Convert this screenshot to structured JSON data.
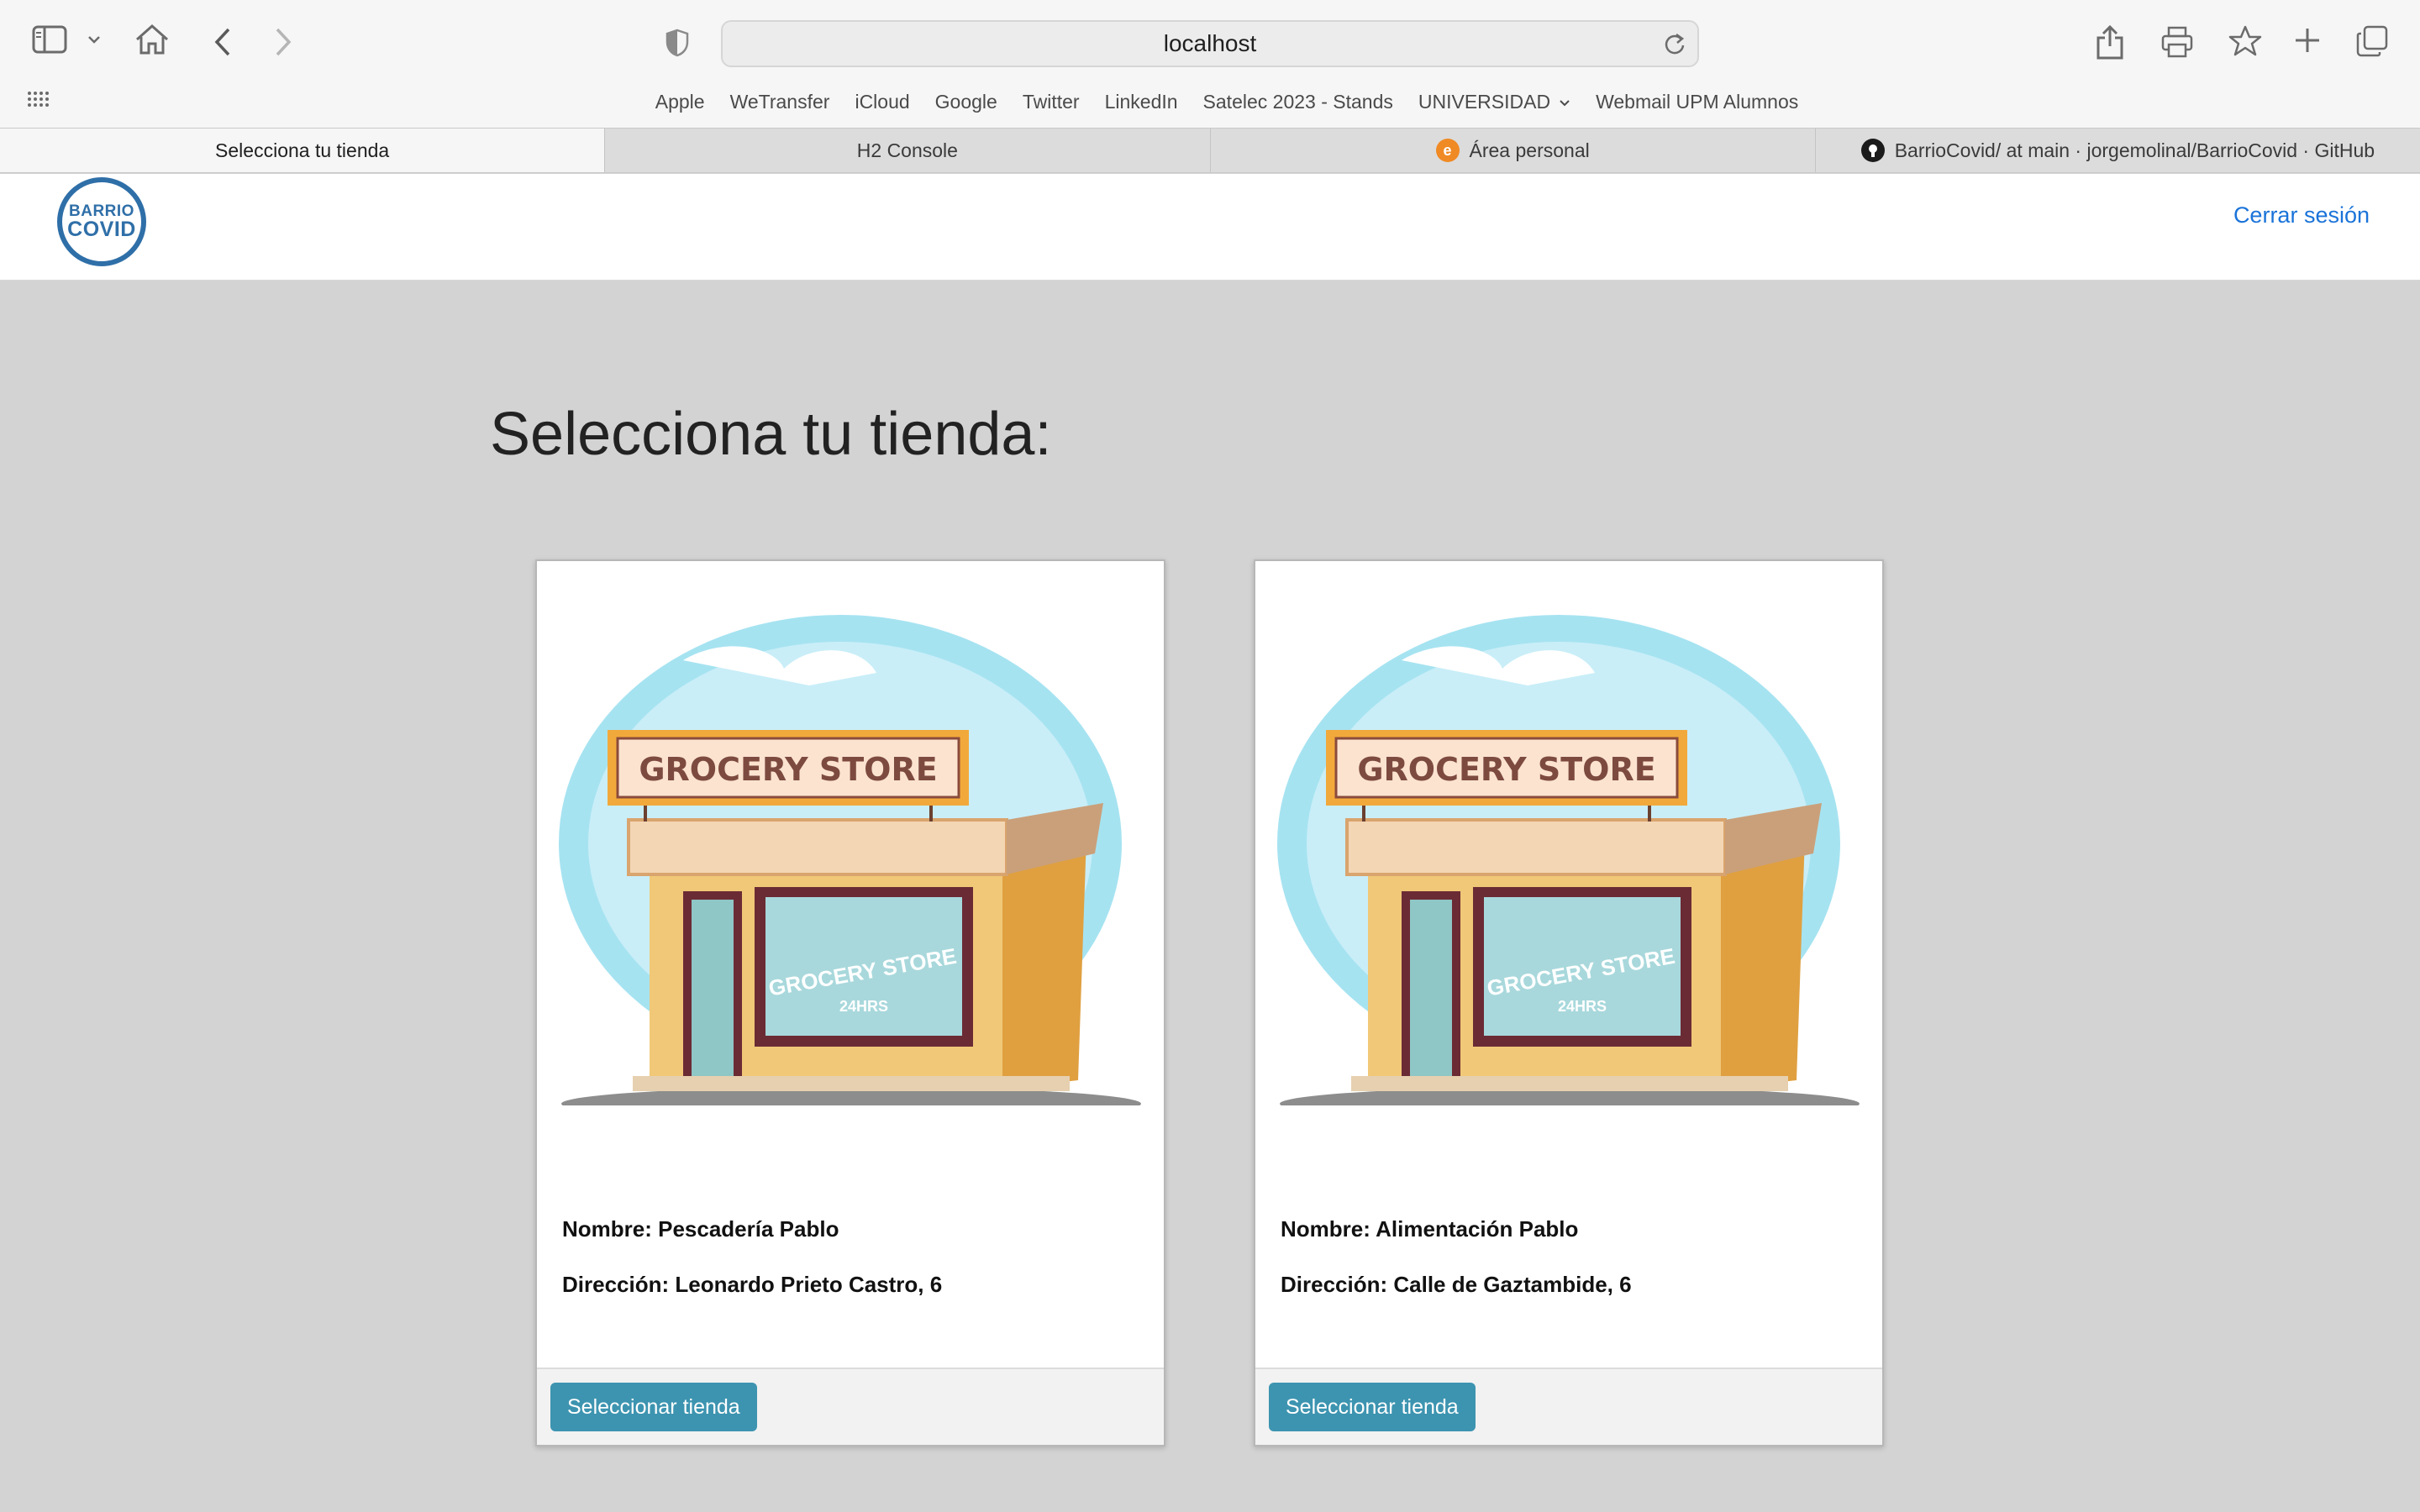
{
  "browser": {
    "address": "localhost",
    "bookmarks": [
      "Apple",
      "WeTransfer",
      "iCloud",
      "Google",
      "Twitter",
      "LinkedIn",
      "Satelec 2023 - Stands",
      "UNIVERSIDAD",
      "Webmail UPM Alumnos"
    ],
    "tabs": [
      {
        "label": "Selecciona tu tienda",
        "active": true
      },
      {
        "label": "H2 Console",
        "active": false
      },
      {
        "label": "Área personal",
        "active": false,
        "favicon": "e"
      },
      {
        "label": "BarrioCovid/ at main · jorgemolinal/BarrioCovid · GitHub",
        "active": false
      }
    ],
    "icons": [
      "sidebar-icon",
      "chevron-down-icon",
      "home-icon",
      "back-icon",
      "forward-icon",
      "privacy-shield-icon",
      "reload-icon",
      "share-icon",
      "print-icon",
      "star-icon",
      "new-tab-icon",
      "tab-overview-icon",
      "grid-icon"
    ]
  },
  "navbar": {
    "logo_top": "BARRIO",
    "logo_bottom": "COVID",
    "logout": "Cerrar sesión"
  },
  "page": {
    "title": "Selecciona tu tienda:"
  },
  "stores": [
    {
      "image_sign": "GROCERY STORE",
      "image_window": "GROCERY STORE",
      "image_hours": "24HRS",
      "name": "Nombre: Pescadería Pablo",
      "address": "Dirección: Leonardo Prieto Castro, 6",
      "button": "Seleccionar tienda"
    },
    {
      "image_sign": "GROCERY STORE",
      "image_window": "GROCERY STORE",
      "image_hours": "24HRS",
      "name": "Nombre: Alimentación Pablo",
      "address": "Dirección: Calle de Gaztambide, 6",
      "button": "Seleccionar tienda"
    }
  ],
  "colors": {
    "page_bg": "#d3d3d3",
    "link": "#1a73d9",
    "button": "#3d94b0",
    "logo": "#2f6fa8"
  }
}
